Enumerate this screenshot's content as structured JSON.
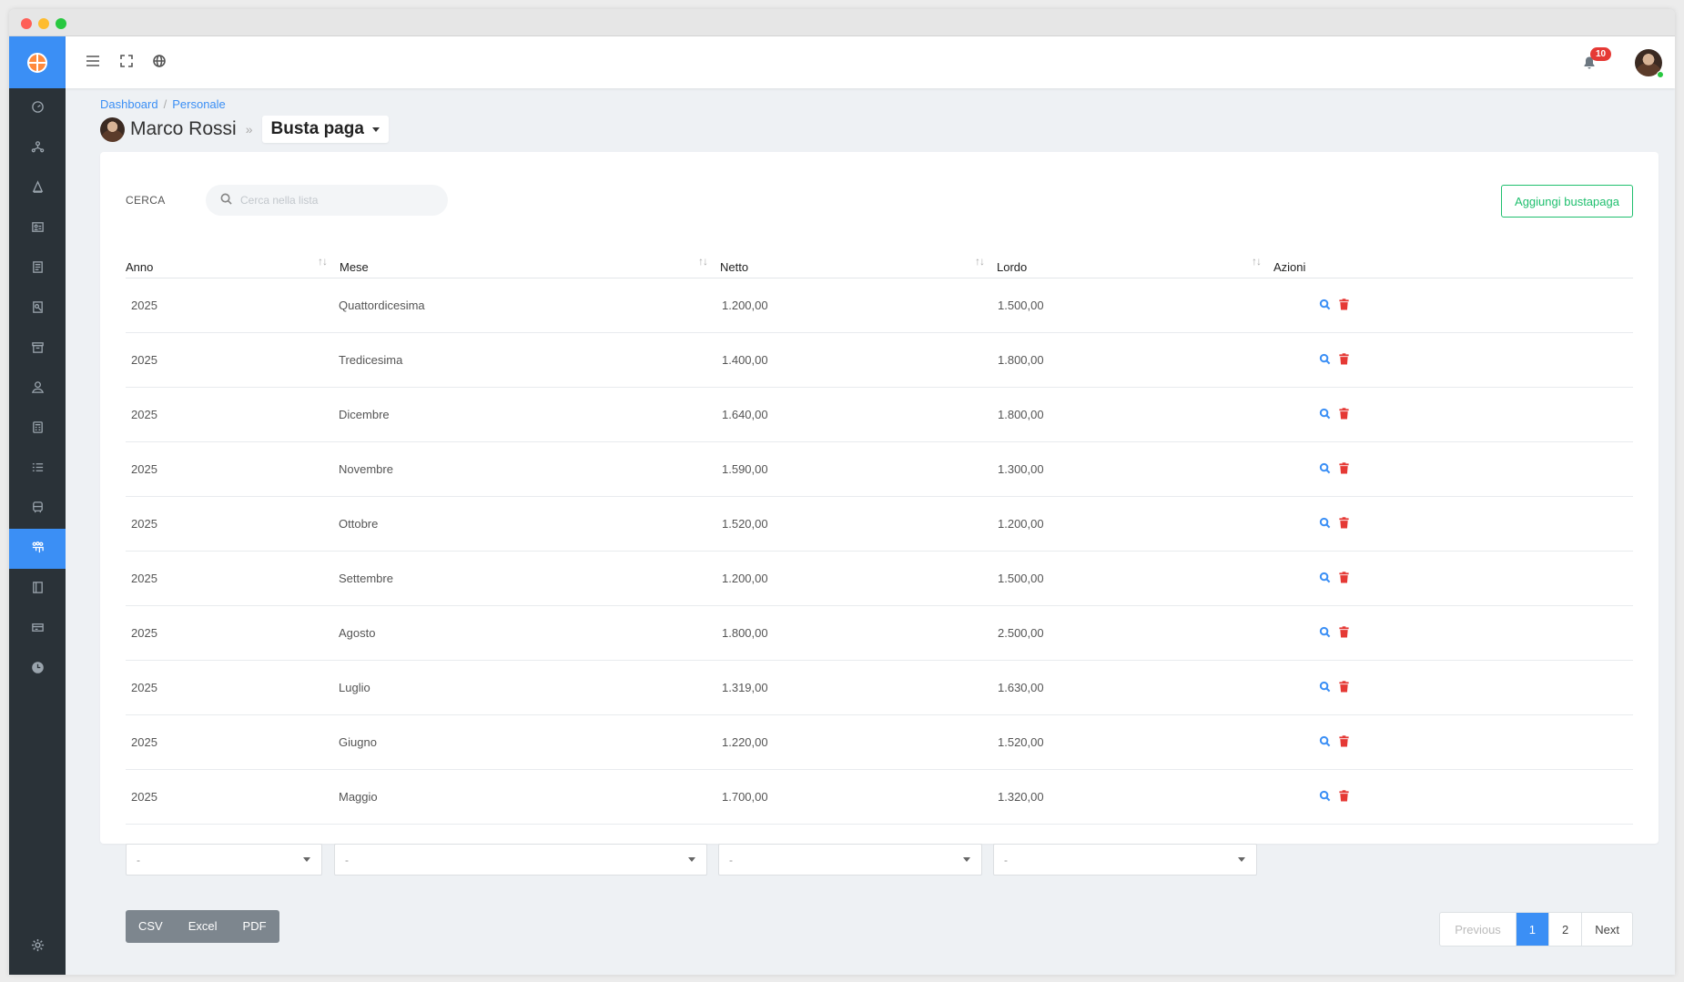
{
  "breadcrumb": [
    "Dashboard",
    "Personale"
  ],
  "person": {
    "name": "Marco Rossi"
  },
  "section": {
    "label": "Busta paga"
  },
  "notifications": {
    "count": "10"
  },
  "search": {
    "label": "CERCA",
    "placeholder": "Cerca nella lista"
  },
  "actions": {
    "add_label": "Aggiungi bustapaga"
  },
  "table": {
    "headers": {
      "anno": "Anno",
      "mese": "Mese",
      "netto": "Netto",
      "lordo": "Lordo",
      "azioni": "Azioni"
    },
    "sort_glyph": "↑↓",
    "rows": [
      {
        "anno": "2025",
        "mese": "Quattordicesima",
        "netto": "1.200,00",
        "lordo": "1.500,00"
      },
      {
        "anno": "2025",
        "mese": "Tredicesima",
        "netto": "1.400,00",
        "lordo": "1.800,00"
      },
      {
        "anno": "2025",
        "mese": "Dicembre",
        "netto": "1.640,00",
        "lordo": "1.800,00"
      },
      {
        "anno": "2025",
        "mese": "Novembre",
        "netto": "1.590,00",
        "lordo": "1.300,00"
      },
      {
        "anno": "2025",
        "mese": "Ottobre",
        "netto": "1.520,00",
        "lordo": "1.200,00"
      },
      {
        "anno": "2025",
        "mese": "Settembre",
        "netto": "1.200,00",
        "lordo": "1.500,00"
      },
      {
        "anno": "2025",
        "mese": "Agosto",
        "netto": "1.800,00",
        "lordo": "2.500,00"
      },
      {
        "anno": "2025",
        "mese": "Luglio",
        "netto": "1.319,00",
        "lordo": "1.630,00"
      },
      {
        "anno": "2025",
        "mese": "Giugno",
        "netto": "1.220,00",
        "lordo": "1.520,00"
      },
      {
        "anno": "2025",
        "mese": "Maggio",
        "netto": "1.700,00",
        "lordo": "1.320,00"
      }
    ]
  },
  "filters": [
    "-",
    "-",
    "-",
    "-"
  ],
  "export": [
    "CSV",
    "Excel",
    "PDF"
  ],
  "pagination": {
    "previous": "Previous",
    "pages": [
      "1",
      "2"
    ],
    "next": "Next",
    "current": "1"
  },
  "colors": {
    "primary": "#3b8ff5",
    "sidebar": "#2a3238",
    "success": "#1fbf6e",
    "danger": "#e53935"
  },
  "sidebar_icons": [
    "dashboard-icon",
    "network-icon",
    "pen-icon",
    "id-card-icon",
    "document-icon",
    "report-icon",
    "archive-icon",
    "user-icon",
    "calculator-icon",
    "list-icon",
    "bus-icon",
    "team-icon",
    "book-icon",
    "ticket-icon",
    "clock-icon"
  ]
}
